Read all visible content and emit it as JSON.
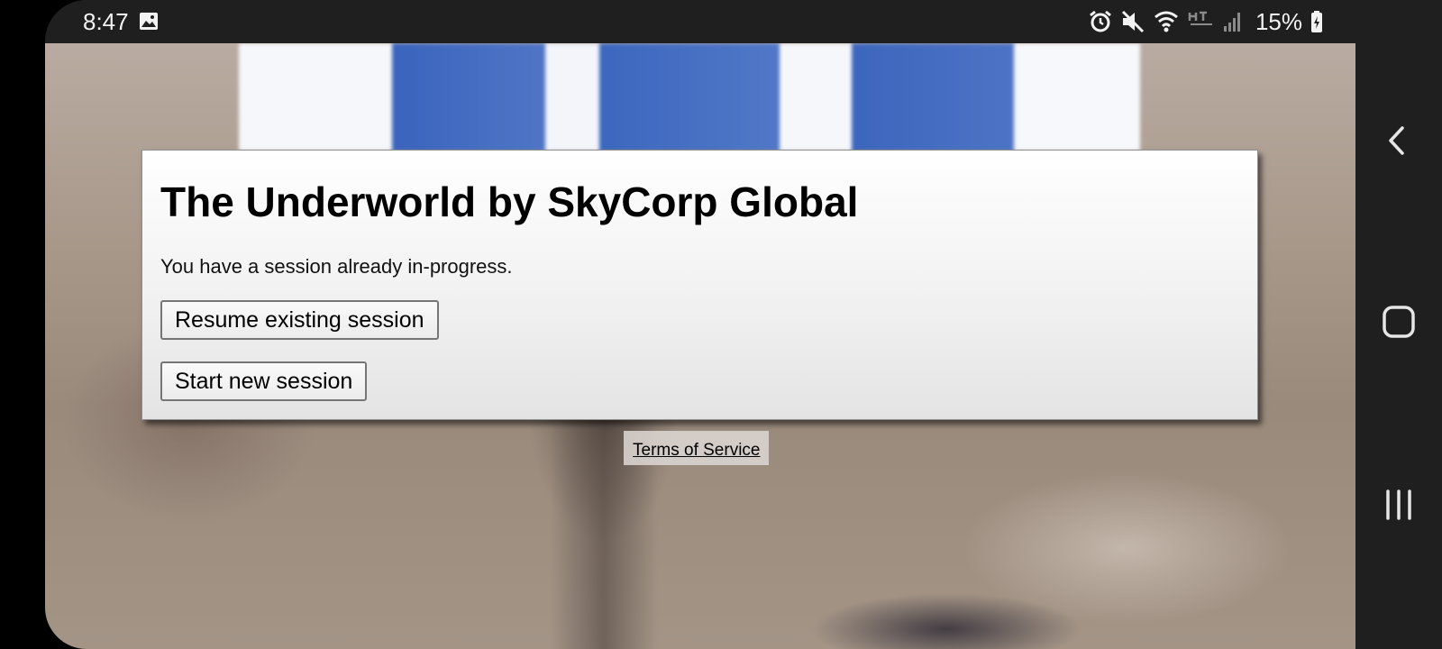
{
  "status_bar": {
    "time": "8:47",
    "battery_percent": "15%",
    "icons": [
      "gallery-icon",
      "alarm-icon",
      "mute-icon",
      "wifi-icon",
      "network-icon",
      "signal-icon",
      "battery-charging-icon"
    ]
  },
  "dialog": {
    "title": "The Underworld by SkyCorp Global",
    "message": "You have a session already in-progress.",
    "resume_label": "Resume existing session",
    "start_label": "Start new session"
  },
  "footer": {
    "terms_label": "Terms of Service"
  },
  "nav_bar": {
    "buttons": [
      "back-icon",
      "home-icon",
      "recents-icon"
    ]
  },
  "colors": {
    "status_bar_bg": "#1f1f1f",
    "dialog_bg": "#f1f1f1",
    "window_blue": "#4a71c4"
  }
}
